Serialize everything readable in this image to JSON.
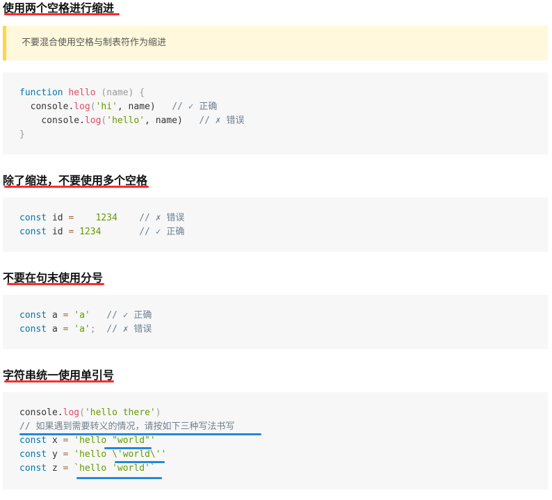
{
  "sections": [
    {
      "heading": "使用两个空格进行缩进"
    },
    {
      "heading": "除了缩进，不要使用多个空格"
    },
    {
      "heading": "不要在句末使用分号"
    },
    {
      "heading": "字符串统一使用单引号"
    }
  ],
  "note": "不要混合使用空格与制表符作为缩进",
  "code1": {
    "l1": {
      "kw": "function",
      "fn": "hello",
      "params": " (name) {"
    },
    "l2": {
      "indent": "  ",
      "obj": "console.",
      "fn": "log",
      "open": "(",
      "str": "'hi'",
      "rest": ", name)",
      "gap": "   ",
      "comment": "// ✓ 正确"
    },
    "l3": {
      "indent": "    ",
      "obj": "console.",
      "fn": "log",
      "open": "(",
      "str": "'hello'",
      "rest": ", name)",
      "gap": "   ",
      "comment": "// ✗ 错误"
    },
    "l4": "}"
  },
  "code2": {
    "l1": {
      "kw": "const",
      "name": " id ",
      "op": "=",
      "gap": "    ",
      "num": "1234",
      "gap2": "    ",
      "comment": "// ✗ 错误"
    },
    "l2": {
      "kw": "const",
      "name": " id ",
      "op": "=",
      "gap": " ",
      "num": "1234",
      "gap2": "       ",
      "comment": "// ✓ 正确"
    }
  },
  "code3": {
    "l1": {
      "kw": "const",
      "name": " a ",
      "op": "=",
      "gap": " ",
      "str": "'a'",
      "semi": "",
      "gap2": "   ",
      "comment": "// ✓ 正确"
    },
    "l2": {
      "kw": "const",
      "name": " a ",
      "op": "=",
      "gap": " ",
      "str": "'a'",
      "semi": ";",
      "gap2": "  ",
      "comment": "// ✗ 错误"
    }
  },
  "code4": {
    "l1": {
      "obj": "console.",
      "fn": "log",
      "open": "(",
      "str": "'hello there'",
      "close": ")"
    },
    "l2": "// 如果遇到需要转义的情况，请按如下三种写法书写",
    "l3": {
      "kw": "const",
      "name": " x ",
      "op": "=",
      "str": "'hello \"world\"'"
    },
    "l4": {
      "kw": "const",
      "name": " y ",
      "op": "=",
      "str": "'hello \\'world\\''"
    },
    "l5": {
      "kw": "const",
      "name": " z ",
      "op": "=",
      "str": "`hello 'world'`"
    }
  }
}
